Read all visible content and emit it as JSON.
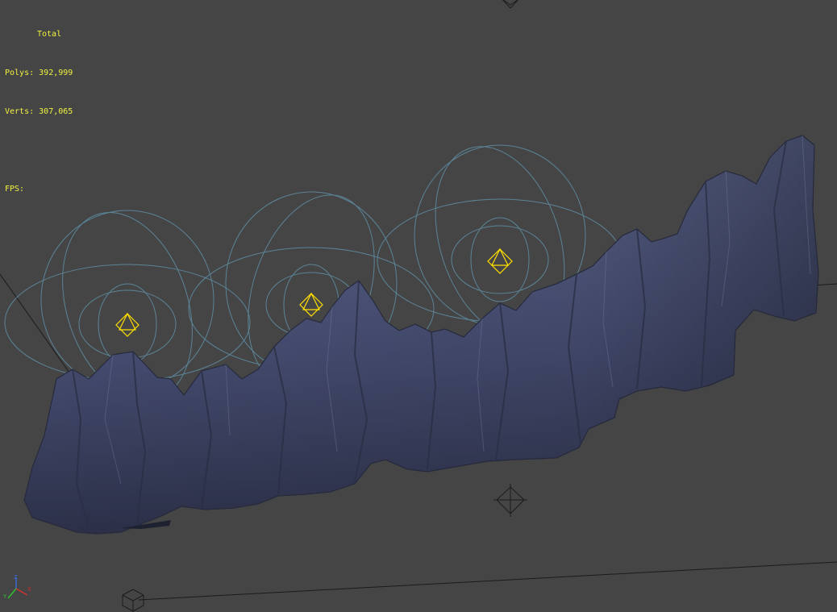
{
  "viewport": {
    "background": "#454545",
    "statistics": {
      "total_label": "Total",
      "polys_label": "Polys:",
      "polys_value": "392,999",
      "verts_label": "Verts:",
      "verts_value": "307,065",
      "fps_label": "FPS:"
    },
    "colors": {
      "stats_text": "#f2f241",
      "light_gizmo": "#ffe000",
      "light_range": "#5f8fa6",
      "rock": "#4a5278",
      "grid_line": "#1a1a1a"
    },
    "icons": {
      "top_gizmo": "light-gizmo-icon",
      "center_helper": "point-helper-icon",
      "view_cube": "view-cube-icon",
      "axis_tripod": "axis-tripod-icon"
    },
    "axis_labels": {
      "z": "Z",
      "x": "X",
      "y": "Y"
    }
  }
}
